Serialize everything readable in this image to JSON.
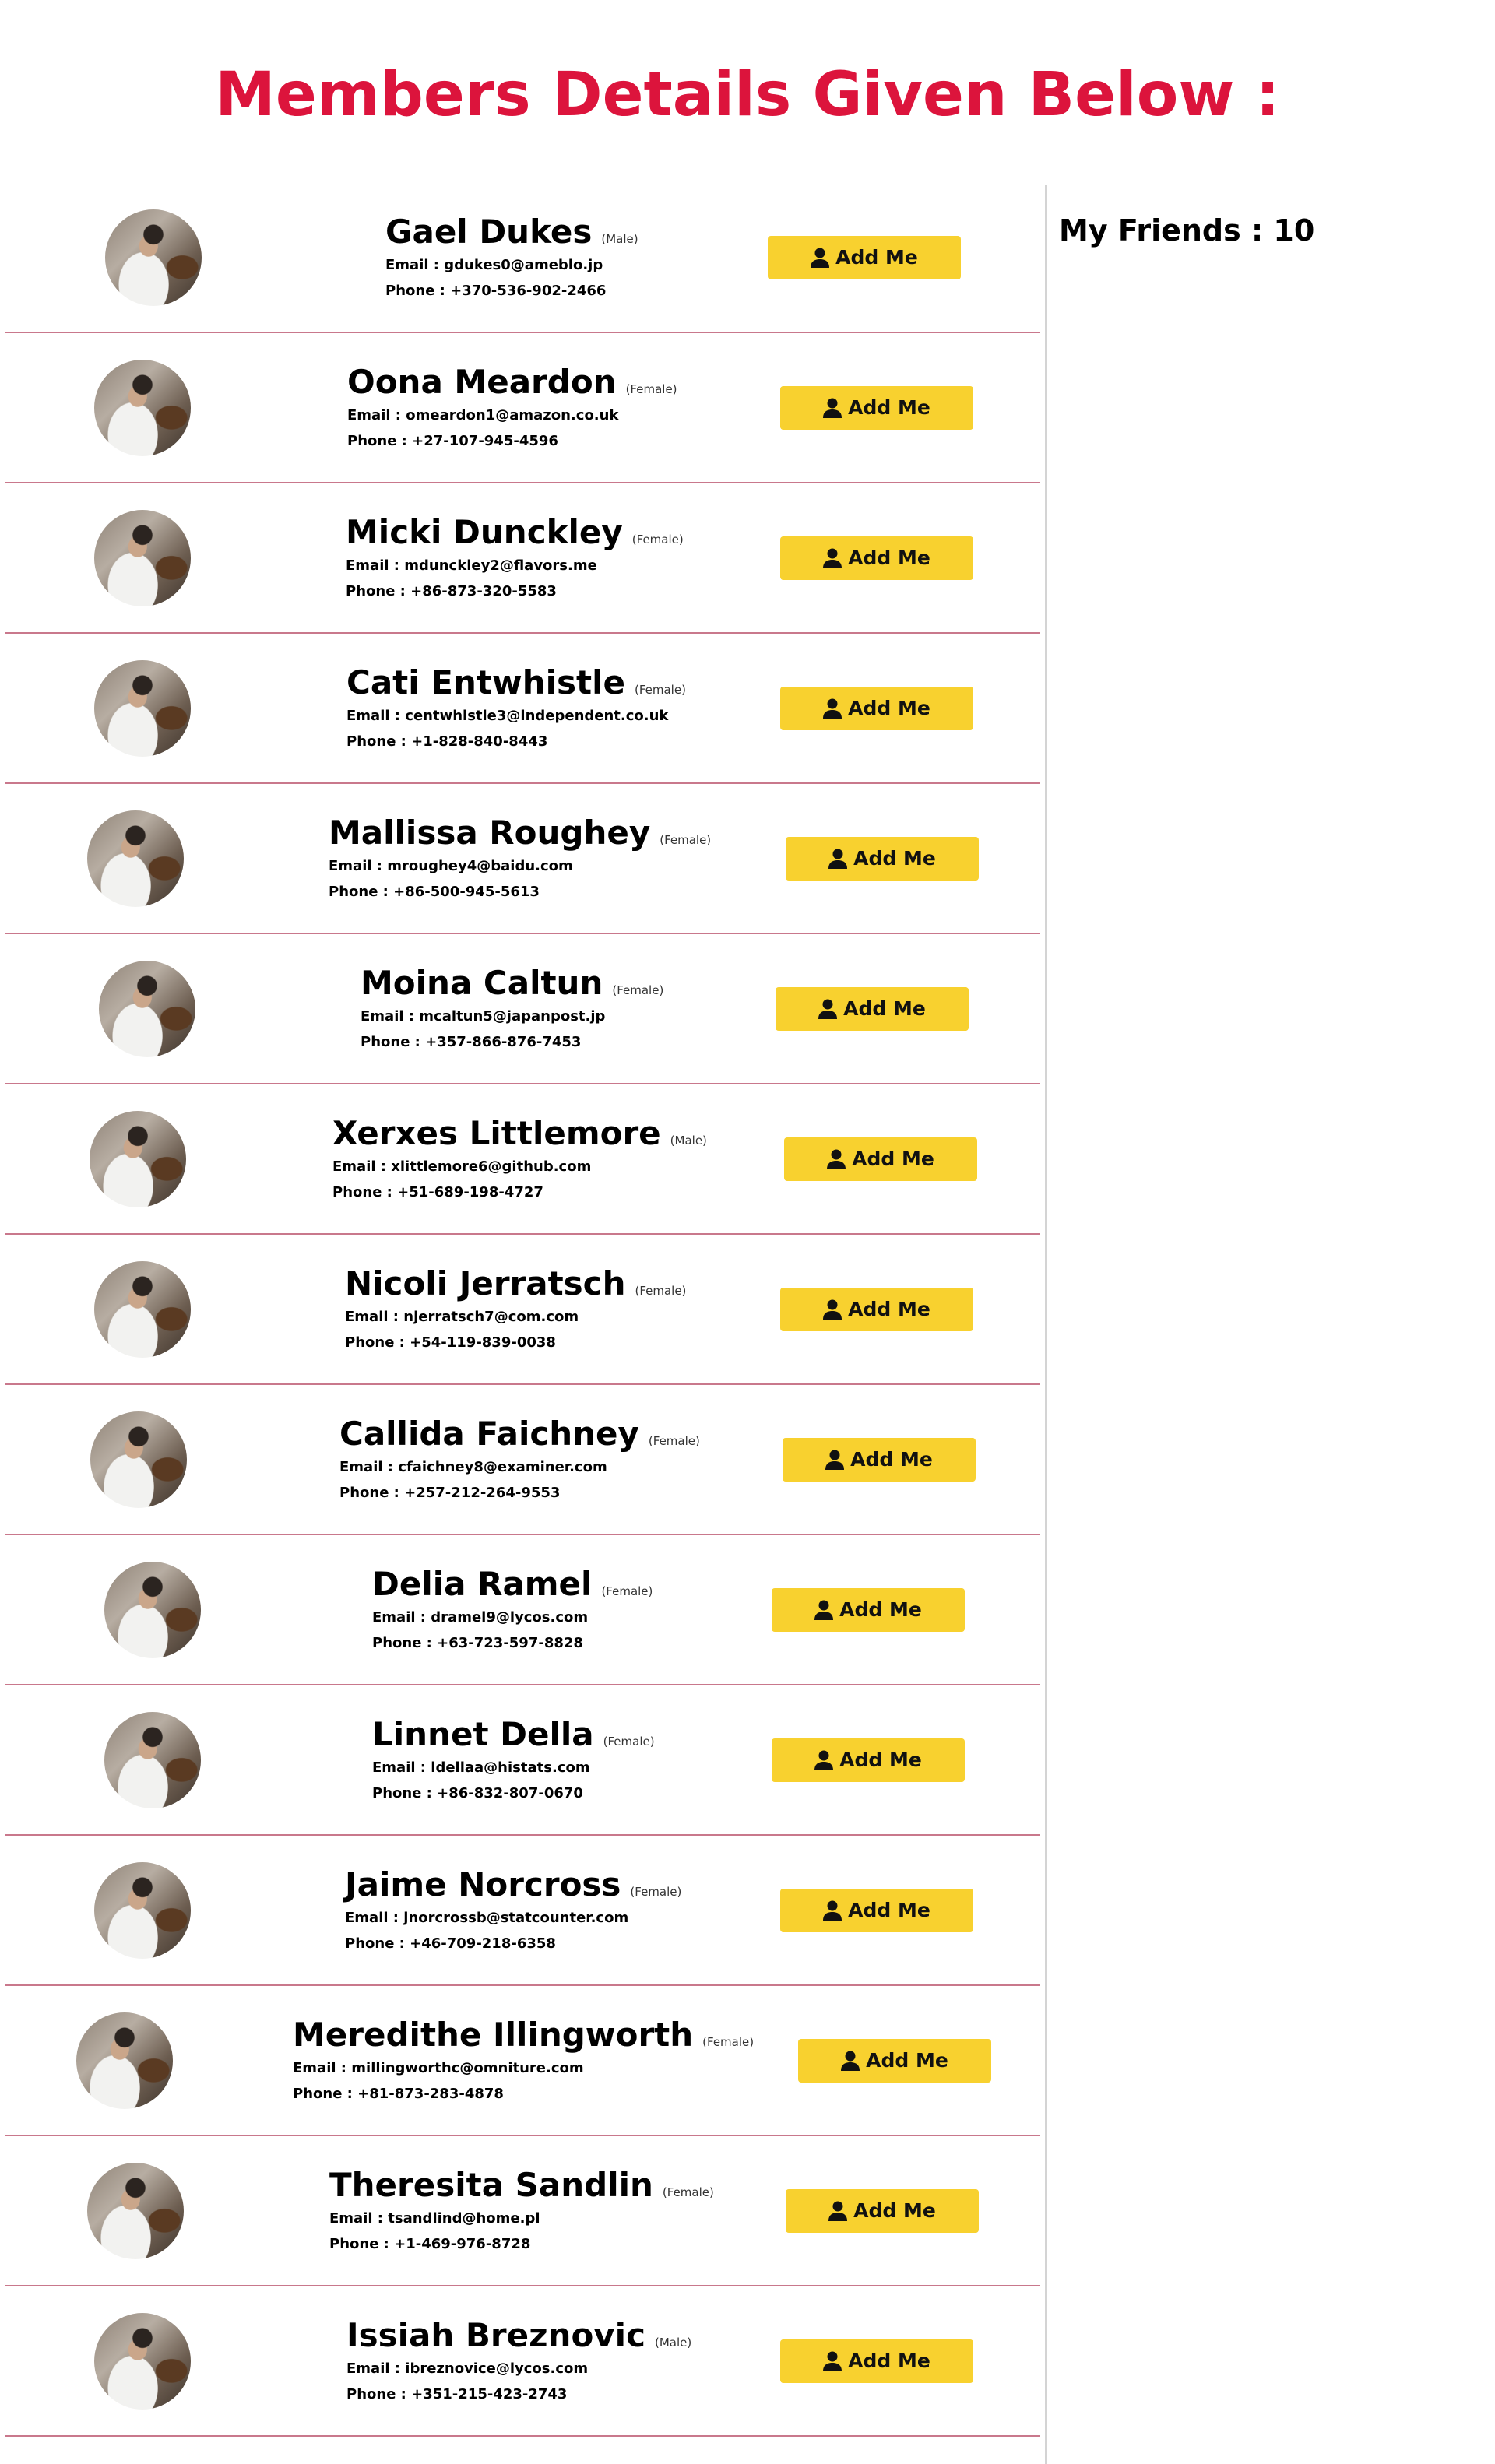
{
  "page": {
    "title": "Members Details Given Below :"
  },
  "labels": {
    "email_prefix": "Email : ",
    "phone_prefix": "Phone : ",
    "add_button": "Add Me"
  },
  "friends": {
    "text": "My Friends : 10"
  },
  "members": [
    {
      "name": "Gael Dukes",
      "gender": "(Male)",
      "email": "gdukes0@ameblo.jp",
      "phone": "+370-536-902-2466"
    },
    {
      "name": "Oona Meardon",
      "gender": "(Female)",
      "email": "omeardon1@amazon.co.uk",
      "phone": "+27-107-945-4596"
    },
    {
      "name": "Micki Dunckley",
      "gender": "(Female)",
      "email": "mdunckley2@flavors.me",
      "phone": "+86-873-320-5583"
    },
    {
      "name": "Cati Entwhistle",
      "gender": "(Female)",
      "email": "centwhistle3@independent.co.uk",
      "phone": "+1-828-840-8443"
    },
    {
      "name": "Mallissa Roughey",
      "gender": "(Female)",
      "email": "mroughey4@baidu.com",
      "phone": "+86-500-945-5613"
    },
    {
      "name": "Moina Caltun",
      "gender": "(Female)",
      "email": "mcaltun5@japanpost.jp",
      "phone": "+357-866-876-7453"
    },
    {
      "name": "Xerxes Littlemore",
      "gender": "(Male)",
      "email": "xlittlemore6@github.com",
      "phone": "+51-689-198-4727"
    },
    {
      "name": "Nicoli Jerratsch",
      "gender": "(Female)",
      "email": "njerratsch7@com.com",
      "phone": "+54-119-839-0038"
    },
    {
      "name": "Callida Faichney",
      "gender": "(Female)",
      "email": "cfaichney8@examiner.com",
      "phone": "+257-212-264-9553"
    },
    {
      "name": "Delia Ramel",
      "gender": "(Female)",
      "email": "dramel9@lycos.com",
      "phone": "+63-723-597-8828"
    },
    {
      "name": "Linnet Della",
      "gender": "(Female)",
      "email": "ldellaa@histats.com",
      "phone": "+86-832-807-0670"
    },
    {
      "name": "Jaime Norcross",
      "gender": "(Female)",
      "email": "jnorcrossb@statcounter.com",
      "phone": "+46-709-218-6358"
    },
    {
      "name": "Meredithe Illingworth",
      "gender": "(Female)",
      "email": "millingworthc@omniture.com",
      "phone": "+81-873-283-4878"
    },
    {
      "name": "Theresita Sandlin",
      "gender": "(Female)",
      "email": "tsandlind@home.pl",
      "phone": "+1-469-976-8728"
    },
    {
      "name": "Issiah Breznovic",
      "gender": "(Male)",
      "email": "ibreznovice@lycos.com",
      "phone": "+351-215-423-2743"
    }
  ]
}
